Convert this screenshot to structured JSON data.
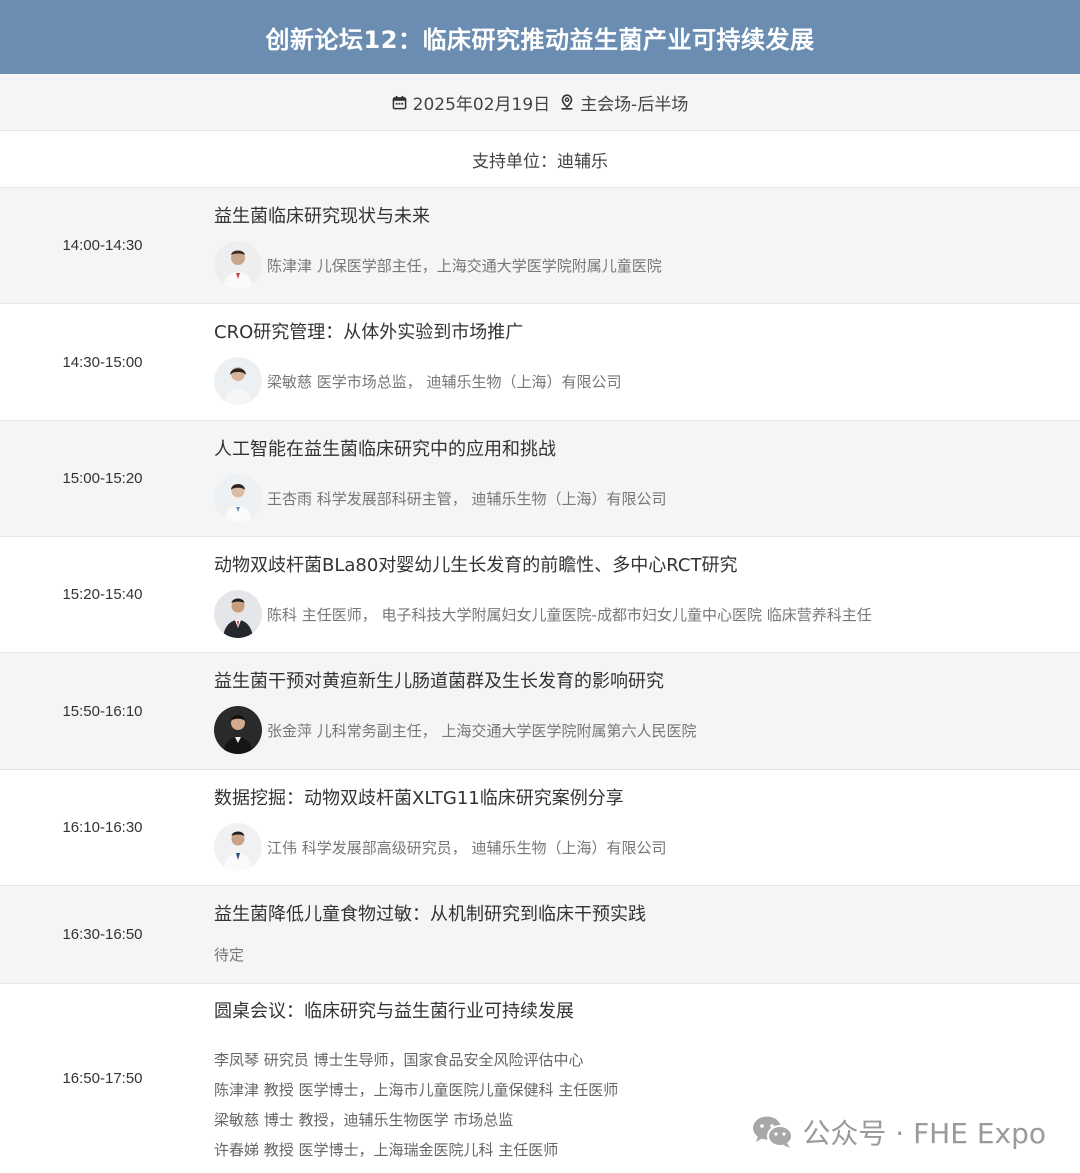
{
  "header": {
    "title": "创新论坛12：临床研究推动益生菌产业可持续发展"
  },
  "meta": {
    "date": "2025年02月19日",
    "venue": "主会场-后半场",
    "support": "支持单位：迪辅乐"
  },
  "sessions": [
    {
      "time": "14:00-14:30",
      "title": "益生菌临床研究现状与未来",
      "speaker": "陈津津 儿保医学部主任，上海交通大学医学院附属儿童医院"
    },
    {
      "time": "14:30-15:00",
      "title": "CRO研究管理：从体外实验到市场推广",
      "speaker": "梁敏慈 医学市场总监， 迪辅乐生物（上海）有限公司"
    },
    {
      "time": "15:00-15:20",
      "title": "人工智能在益生菌临床研究中的应用和挑战",
      "speaker": "王杏雨 科学发展部科研主管， 迪辅乐生物（上海）有限公司"
    },
    {
      "time": "15:20-15:40",
      "title": "动物双歧杆菌BLa80对婴幼儿生长发育的前瞻性、多中心RCT研究",
      "speaker": "陈科 主任医师， 电子科技大学附属妇女儿童医院-成都市妇女儿童中心医院 临床营养科主任"
    },
    {
      "time": "15:50-16:10",
      "title": "益生菌干预对黄疸新生儿肠道菌群及生长发育的影响研究",
      "speaker": "张金萍 儿科常务副主任， 上海交通大学医学院附属第六人民医院"
    },
    {
      "time": "16:10-16:30",
      "title": "数据挖掘：动物双歧杆菌XLTG11临床研究案例分享",
      "speaker": "江伟 科学发展部高级研究员， 迪辅乐生物（上海）有限公司"
    },
    {
      "time": "16:30-16:50",
      "title": "益生菌降低儿童食物过敏：从机制研究到临床干预实践",
      "speaker": "待定"
    },
    {
      "time": "16:50-17:50",
      "title": "圆桌会议：临床研究与益生菌行业可持续发展",
      "panel": [
        "李凤琴 研究员 博士生导师，国家食品安全风险评估中心",
        "陈津津 教授 医学博士，上海市儿童医院儿童保健科 主任医师",
        "梁敏慈 博士 教授，迪辅乐生物医学 市场总监",
        "许春娣 教授 医学博士，上海瑞金医院儿科 主任医师"
      ]
    }
  ],
  "watermark": {
    "text": "公众号 · FHE Expo"
  },
  "colors": {
    "header_bg": "#6a8db1",
    "row_shade": "#f5f5f5"
  }
}
